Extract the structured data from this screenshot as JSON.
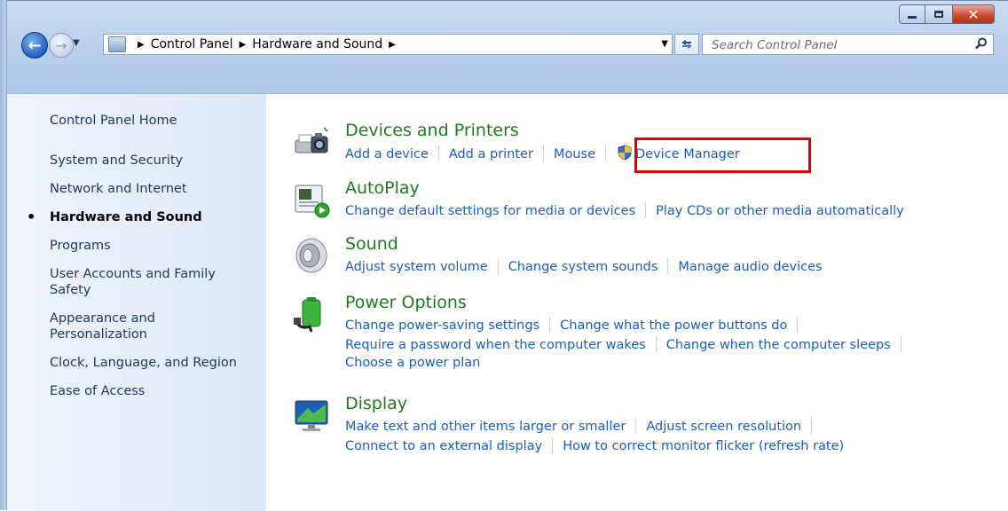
{
  "window": {
    "buttons": {
      "minimize": "minimize",
      "maximize": "maximize",
      "close": "close"
    }
  },
  "nav": {
    "breadcrumbs": [
      "Control Panel",
      "Hardware and Sound"
    ],
    "search_placeholder": "Search Control Panel"
  },
  "sidebar": {
    "home": "Control Panel Home",
    "items": [
      {
        "label": "System and Security",
        "current": false
      },
      {
        "label": "Network and Internet",
        "current": false
      },
      {
        "label": "Hardware and Sound",
        "current": true
      },
      {
        "label": "Programs",
        "current": false
      },
      {
        "label": "User Accounts and Family Safety",
        "current": false
      },
      {
        "label": "Appearance and Personalization",
        "current": false
      },
      {
        "label": "Clock, Language, and Region",
        "current": false
      },
      {
        "label": "Ease of Access",
        "current": false
      }
    ]
  },
  "categories": [
    {
      "title": "Devices and Printers",
      "icon": "printer-camera-icon",
      "rows": [
        [
          "Add a device",
          "Add a printer",
          "Mouse",
          "Device Manager"
        ]
      ]
    },
    {
      "title": "AutoPlay",
      "icon": "autoplay-icon",
      "rows": [
        [
          "Change default settings for media or devices",
          "Play CDs or other media automatically"
        ]
      ]
    },
    {
      "title": "Sound",
      "icon": "speaker-icon",
      "rows": [
        [
          "Adjust system volume",
          "Change system sounds",
          "Manage audio devices"
        ]
      ]
    },
    {
      "title": "Power Options",
      "icon": "battery-plug-icon",
      "rows": [
        [
          "Change power-saving settings",
          "Change what the power buttons do"
        ],
        [
          "Require a password when the computer wakes",
          "Change when the computer sleeps"
        ],
        [
          "Choose a power plan"
        ]
      ]
    },
    {
      "title": "Display",
      "icon": "monitor-icon",
      "rows": [
        [
          "Make text and other items larger or smaller",
          "Adjust screen resolution"
        ],
        [
          "Connect to an external display",
          "How to correct monitor flicker (refresh rate)"
        ]
      ]
    }
  ],
  "colors": {
    "link": "#1a5dc1",
    "category_title": "#1e7a1e",
    "highlight": "#e00000"
  }
}
